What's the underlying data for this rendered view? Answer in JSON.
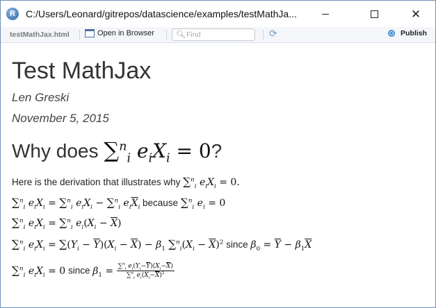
{
  "window": {
    "title": "C:/Users/Leonard/gitrepos/datascience/examples/testMathJa...",
    "app_icon_letter": "R"
  },
  "toolbar": {
    "file_name": "testMathJax.html",
    "open_browser_label": "Open in Browser",
    "search_placeholder": "Find",
    "publish_label": "Publish"
  },
  "document": {
    "title": "Test MathJax",
    "author": "Len Greski",
    "date": "November 5, 2015",
    "heading_prefix": "Why does",
    "heading_suffix": "?",
    "intro_text": "Here is the derivation that illustrates why",
    "because_text": "because",
    "since_text_1": "since",
    "since_text_2": "since"
  },
  "colors": {
    "window_border": "#6d8fb5",
    "toolbar_bg": "#f4f6f9",
    "publish_accent": "#3d8fd6"
  },
  "icons": {
    "app": "r-logo-icon",
    "open_browser": "browser-window-icon",
    "search": "search-icon",
    "refresh": "refresh-icon",
    "publish": "publish-icon"
  }
}
